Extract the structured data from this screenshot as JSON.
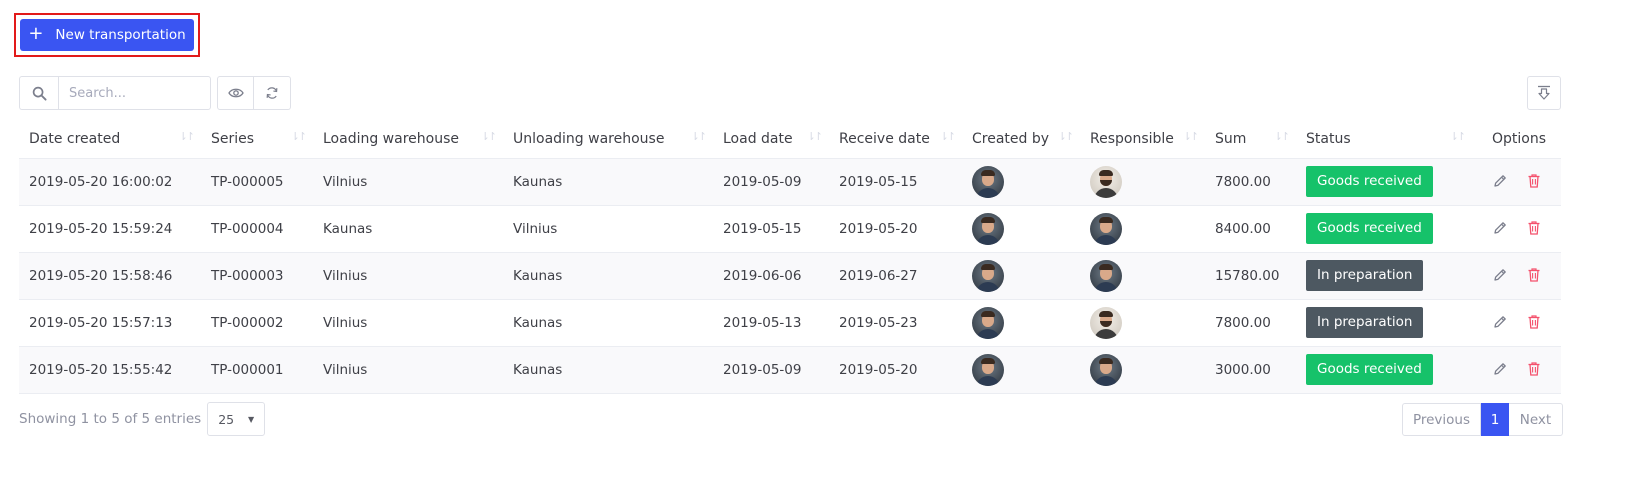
{
  "toolbar": {
    "new_button_label": "New transportation",
    "new_button_icon": "plus-icon",
    "search_placeholder": "Search...",
    "search_value": ""
  },
  "table": {
    "columns": [
      "Date created",
      "Series",
      "Loading warehouse",
      "Unloading warehouse",
      "Load date",
      "Receive date",
      "Created by",
      "Responsible",
      "Sum",
      "Status",
      "Options"
    ],
    "rows": [
      {
        "date_created": "2019-05-20 16:00:02",
        "series": "TP-000005",
        "loading": "Vilnius",
        "unloading": "Kaunas",
        "load_date": "2019-05-09",
        "receive_date": "2019-05-15",
        "sum": "7800.00",
        "status": "Goods received"
      },
      {
        "date_created": "2019-05-20 15:59:24",
        "series": "TP-000004",
        "loading": "Kaunas",
        "unloading": "Vilnius",
        "load_date": "2019-05-15",
        "receive_date": "2019-05-20",
        "sum": "8400.00",
        "status": "Goods received"
      },
      {
        "date_created": "2019-05-20 15:58:46",
        "series": "TP-000003",
        "loading": "Vilnius",
        "unloading": "Kaunas",
        "load_date": "2019-06-06",
        "receive_date": "2019-06-27",
        "sum": "15780.00",
        "status": "In preparation"
      },
      {
        "date_created": "2019-05-20 15:57:13",
        "series": "TP-000002",
        "loading": "Vilnius",
        "unloading": "Kaunas",
        "load_date": "2019-05-13",
        "receive_date": "2019-05-23",
        "sum": "7800.00",
        "status": "In preparation"
      },
      {
        "date_created": "2019-05-20 15:55:42",
        "series": "TP-000001",
        "loading": "Vilnius",
        "unloading": "Kaunas",
        "load_date": "2019-05-09",
        "receive_date": "2019-05-20",
        "sum": "3000.00",
        "status": "Goods received"
      }
    ]
  },
  "footer": {
    "info": "Showing 1 to 5 of 5 entries",
    "page_size": "25",
    "pagination": {
      "previous": "Previous",
      "current": "1",
      "next": "Next"
    }
  },
  "colors": {
    "primary": "#3a55f2",
    "highlight_border": "#e21a1a",
    "status_received": "#16c26a",
    "status_preparation": "#4d5861",
    "delete": "#f4516c"
  }
}
